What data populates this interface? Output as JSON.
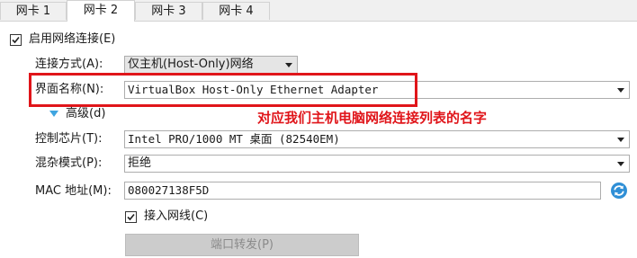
{
  "tabs": [
    "网卡 1",
    "网卡 2",
    "网卡 3",
    "网卡 4"
  ],
  "active_tab": 1,
  "enable_adapter": {
    "label": "启用网络连接(E)",
    "checked": true
  },
  "attached_to": {
    "label": "连接方式(A):",
    "value": "仅主机(Host-Only)网络"
  },
  "name": {
    "label": "界面名称(N):",
    "value": "VirtualBox Host-Only Ethernet Adapter"
  },
  "advanced": {
    "label": "高级(d)"
  },
  "annotation": "对应我们主机电脑网络连接列表的名字",
  "adapter_type": {
    "label": "控制芯片(T):",
    "value": "Intel PRO/1000 MT 桌面 (82540EM)"
  },
  "promiscuous": {
    "label": "混杂模式(P):",
    "value": "拒绝"
  },
  "mac": {
    "label": "MAC 地址(M):",
    "value": "080027138F5D"
  },
  "cable_connected": {
    "label": "接入网线(C)",
    "checked": true
  },
  "port_forwarding": {
    "label": "端口转发(P)"
  },
  "colors": {
    "annotation_red": "#e0151a",
    "triangle_blue": "#3fa5e0"
  }
}
